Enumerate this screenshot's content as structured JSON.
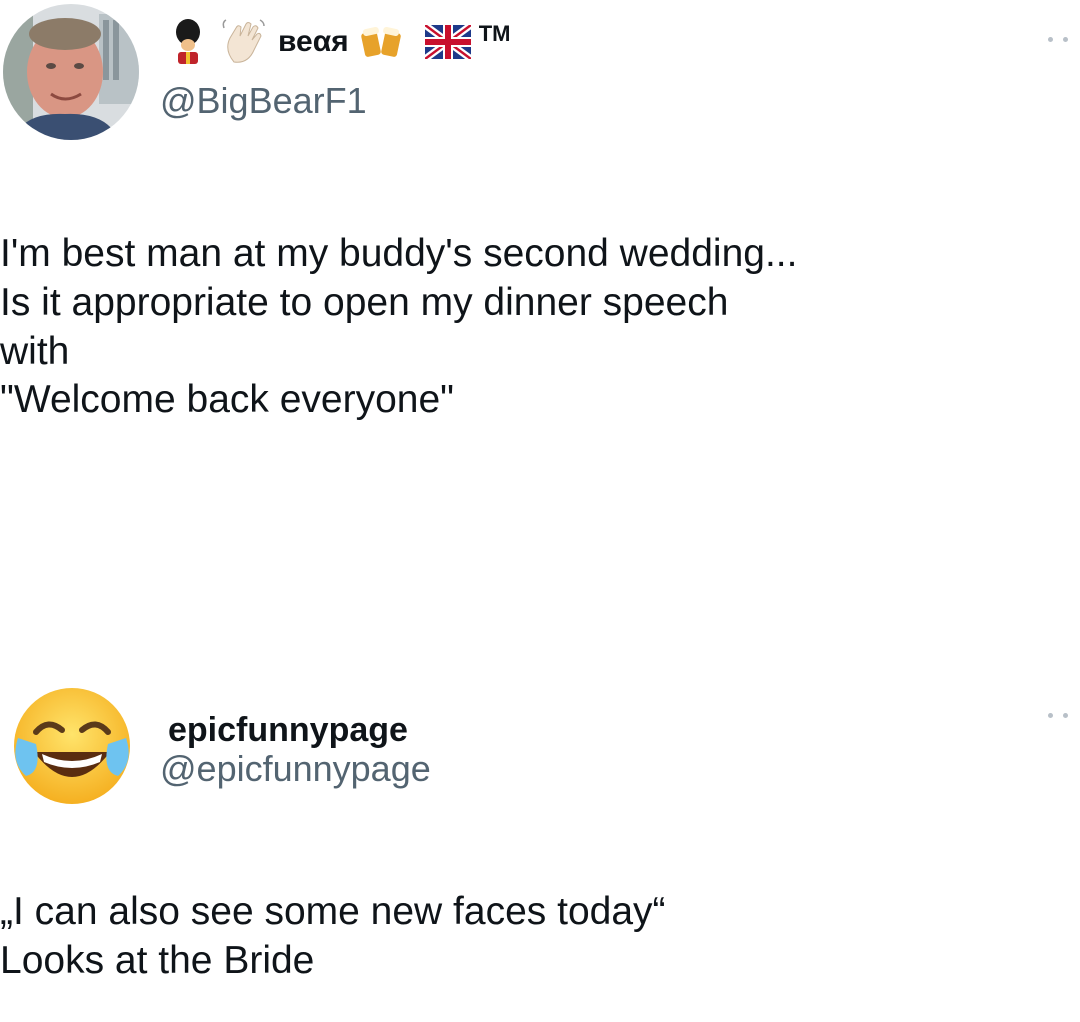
{
  "tweets": [
    {
      "display_name": "веαя",
      "name_suffix": "TM",
      "handle": "@BigBearF1",
      "avatar_icon": "profile-photo",
      "name_emojis": [
        "guard-emoji-icon",
        "waving-hand-emoji-icon",
        "beer-mugs-emoji-icon",
        "uk-flag-emoji-icon"
      ],
      "text_lines": [
        "I'm best man at my buddy's second wedding...",
        "Is it appropriate to open my dinner speech",
        "with",
        "\"Welcome back everyone\""
      ]
    },
    {
      "display_name": "epicfunnypage",
      "handle": "@epicfunnypage",
      "avatar_icon": "tears-of-joy-emoji",
      "text_lines": [
        "„I can also see some new faces today“",
        "Looks at the Bride"
      ]
    }
  ],
  "colors": {
    "text": "#0f1419",
    "secondary": "#536471",
    "background": "#ffffff"
  }
}
